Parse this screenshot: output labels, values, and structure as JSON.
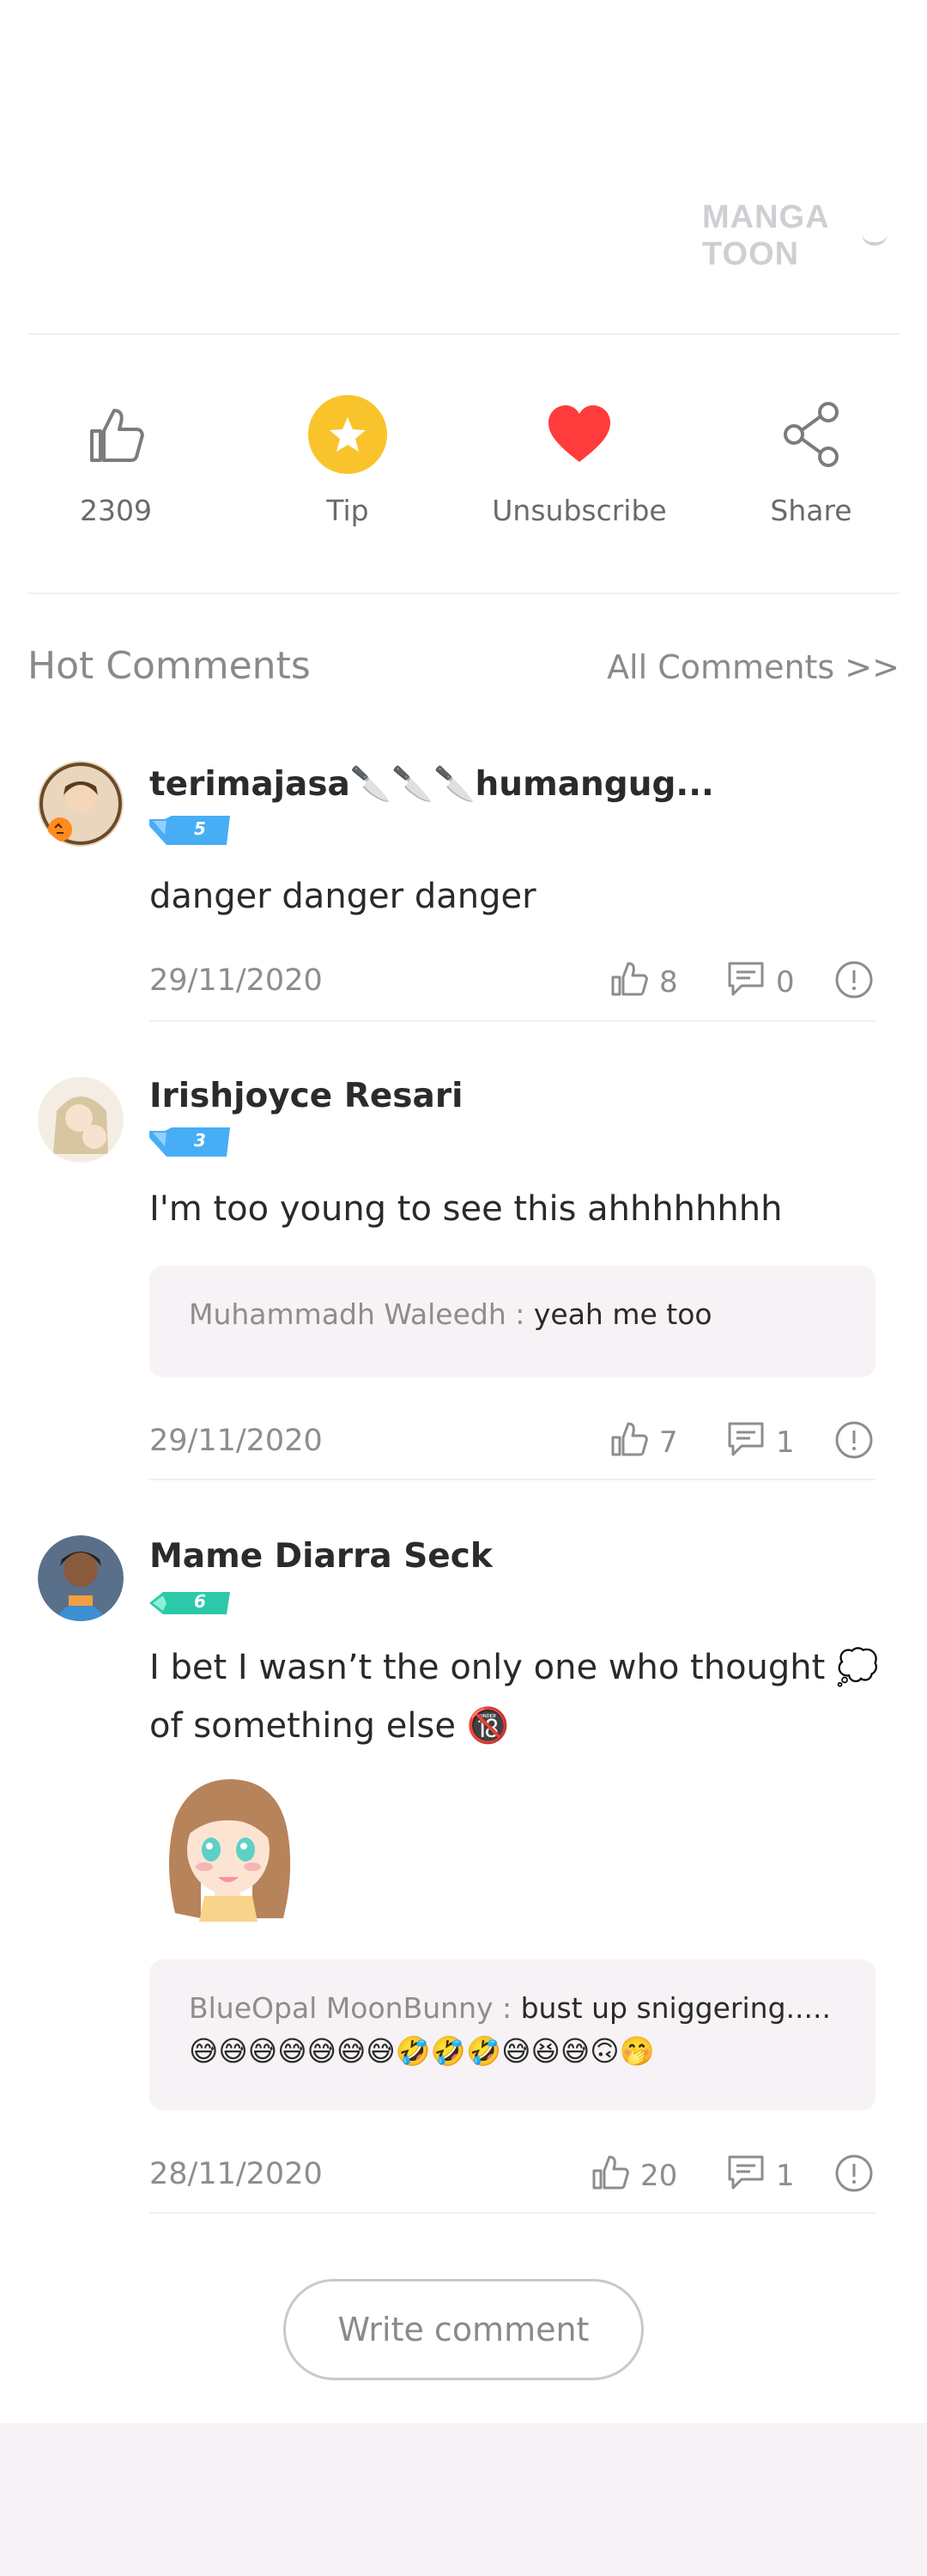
{
  "logo": {
    "text": "MANGA TOON"
  },
  "actions": {
    "like_count": "2309",
    "tip_label": "Tip",
    "subscribe_label": "Unsubscribe",
    "share_label": "Share",
    "heart_color": "#ff3b3b",
    "tip_color": "#f9c42b"
  },
  "section": {
    "title": "Hot Comments",
    "all_link": "All Comments >>"
  },
  "comments": [
    {
      "username": "terimajasa🔪🔪🔪humangug...",
      "level": "5",
      "text": "danger danger danger",
      "date": "29/11/2020",
      "likes": "8",
      "replies": "0"
    },
    {
      "username": "Irishjoyce Resari",
      "level": "3",
      "text": "I'm too young to see this ahhhhhhhh",
      "reply_author": "Muhammadh Waleedh : ",
      "reply_text": "yeah me too",
      "date": "29/11/2020",
      "likes": "7",
      "replies": "1"
    },
    {
      "username": "Mame Diarra Seck",
      "level": "6",
      "text_line1": "I bet I wasn’t the only one who thought 💭",
      "text_line2": "of something else 🔞",
      "reply_author": "BlueOpal MoonBunny : ",
      "reply_text": "bust up sniggering.....",
      "reply_emojis": "😅😅😅😅😅😅😅🤣🤣🤣😅😆😅🙃🤭",
      "date": "28/11/2020",
      "likes": "20",
      "replies": "1"
    }
  ],
  "write_comment": "Write comment"
}
